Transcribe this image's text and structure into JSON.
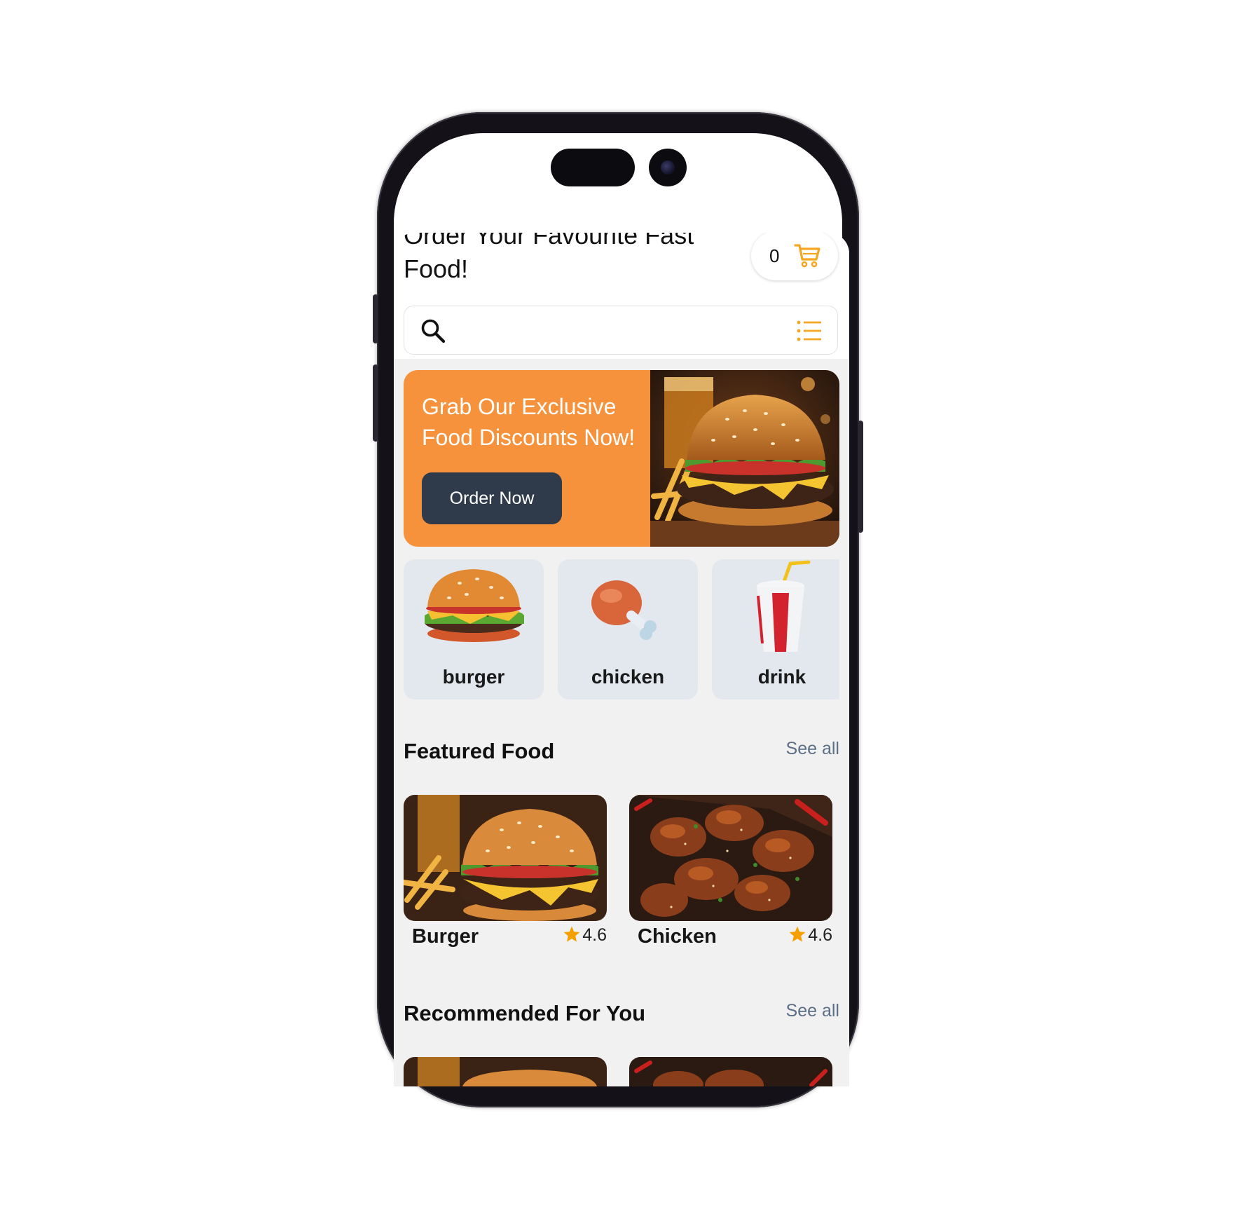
{
  "header": {
    "title": "Order Your Favourite Fast Food!",
    "cart_count": "0"
  },
  "search": {
    "placeholder": ""
  },
  "banner": {
    "text": "Grab Our Exclusive Food Discounts Now!",
    "button_label": "Order Now"
  },
  "categories": [
    {
      "label": "burger",
      "icon": "burger-icon"
    },
    {
      "label": "chicken",
      "icon": "chicken-leg-icon"
    },
    {
      "label": "drink",
      "icon": "soda-cup-icon"
    }
  ],
  "featured": {
    "title": "Featured Food",
    "see_all": "See all",
    "items": [
      {
        "name": "Burger",
        "rating": "4.6"
      },
      {
        "name": "Chicken",
        "rating": "4.6"
      }
    ]
  },
  "recommended": {
    "title": "Recommended For You",
    "see_all": "See all"
  },
  "colors": {
    "accent": "#f6923b",
    "button_dark": "#2f3a4a",
    "icon_orange": "#f5a623",
    "category_bg": "#e3e8ef",
    "see_all": "#5c6f86"
  }
}
